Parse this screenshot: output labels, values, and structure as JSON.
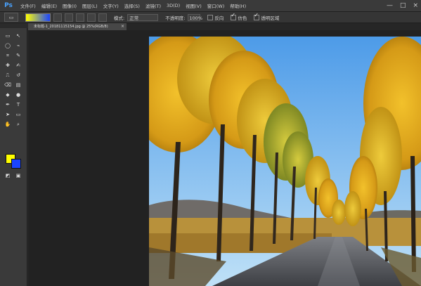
{
  "app": {
    "logo": "Ps"
  },
  "menu": {
    "items": [
      "文件(F)",
      "编辑(E)",
      "图像(I)",
      "图层(L)",
      "文字(Y)",
      "选择(S)",
      "滤镜(T)",
      "3D(D)",
      "视图(V)",
      "窗口(W)",
      "帮助(H)"
    ]
  },
  "window_controls": {
    "minimize": "—",
    "maximize": "□",
    "close": "×"
  },
  "options": {
    "mode_label": "模式:",
    "mode_value": "正常",
    "opacity_label": "不透明度:",
    "opacity_value": "100%",
    "reverse_label": "反向",
    "dither_label": "仿色",
    "transparency_label": "透明区域"
  },
  "document": {
    "tab_title": "未标题-1_20181115154.jpg @ 25%(RGB/8)",
    "close_label": "×"
  },
  "colors": {
    "foreground": "#ffff00",
    "background": "#1a44ff"
  },
  "tools": [
    "move-tool",
    "marquee-tool",
    "lasso-tool",
    "quick-select-tool",
    "crop-tool",
    "eyedropper-tool",
    "spot-heal-tool",
    "brush-tool",
    "clone-stamp-tool",
    "history-brush-tool",
    "eraser-tool",
    "gradient-tool",
    "blur-tool",
    "dodge-tool",
    "pen-tool",
    "type-tool",
    "path-select-tool",
    "shape-tool",
    "hand-tool",
    "zoom-tool"
  ]
}
